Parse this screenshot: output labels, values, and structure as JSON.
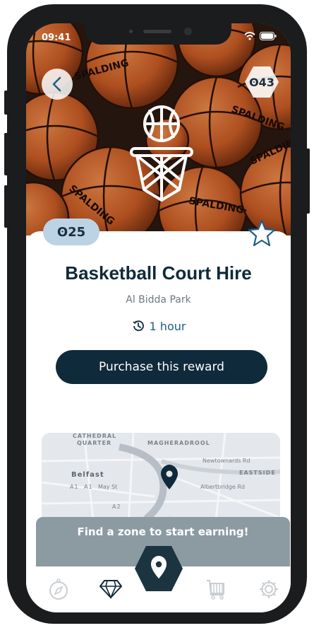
{
  "status_bar": {
    "time": "09:41"
  },
  "header": {
    "points_balance": "ʘ43"
  },
  "reward": {
    "cost": "ʘ25",
    "title": "Basketball Court Hire",
    "location": "Al Bidda Park",
    "duration": "1 hour",
    "purchase_label": "Purchase this reward"
  },
  "map": {
    "labels": {
      "cathedral": "CATHEDRAL",
      "quarter": "QUARTER",
      "magheradrool": "MAGHERADROOL",
      "belfast": "Belfast",
      "newlownards": "Newtownards Rd",
      "eastside": "EASTSIDE",
      "albertbridge": "Albertbridge Rd",
      "a1": "A1",
      "a1b": "A1",
      "mayst": "May St",
      "a2": "A2"
    }
  },
  "banner": {
    "text": "Find a zone to start earning!"
  },
  "tabbar": {
    "items": [
      {
        "icon": "compass-icon",
        "active": false
      },
      {
        "icon": "diamond-icon",
        "active": true
      },
      {
        "icon": "location-pin-icon",
        "active": true
      },
      {
        "icon": "cart-icon",
        "active": false
      },
      {
        "icon": "gear-icon",
        "active": false
      }
    ]
  },
  "colors": {
    "primary": "#0f2a3a",
    "accent_blue": "#1f5e87",
    "badge_bg": "#bcd3e6",
    "banner_bg": "#8c9aa2"
  }
}
